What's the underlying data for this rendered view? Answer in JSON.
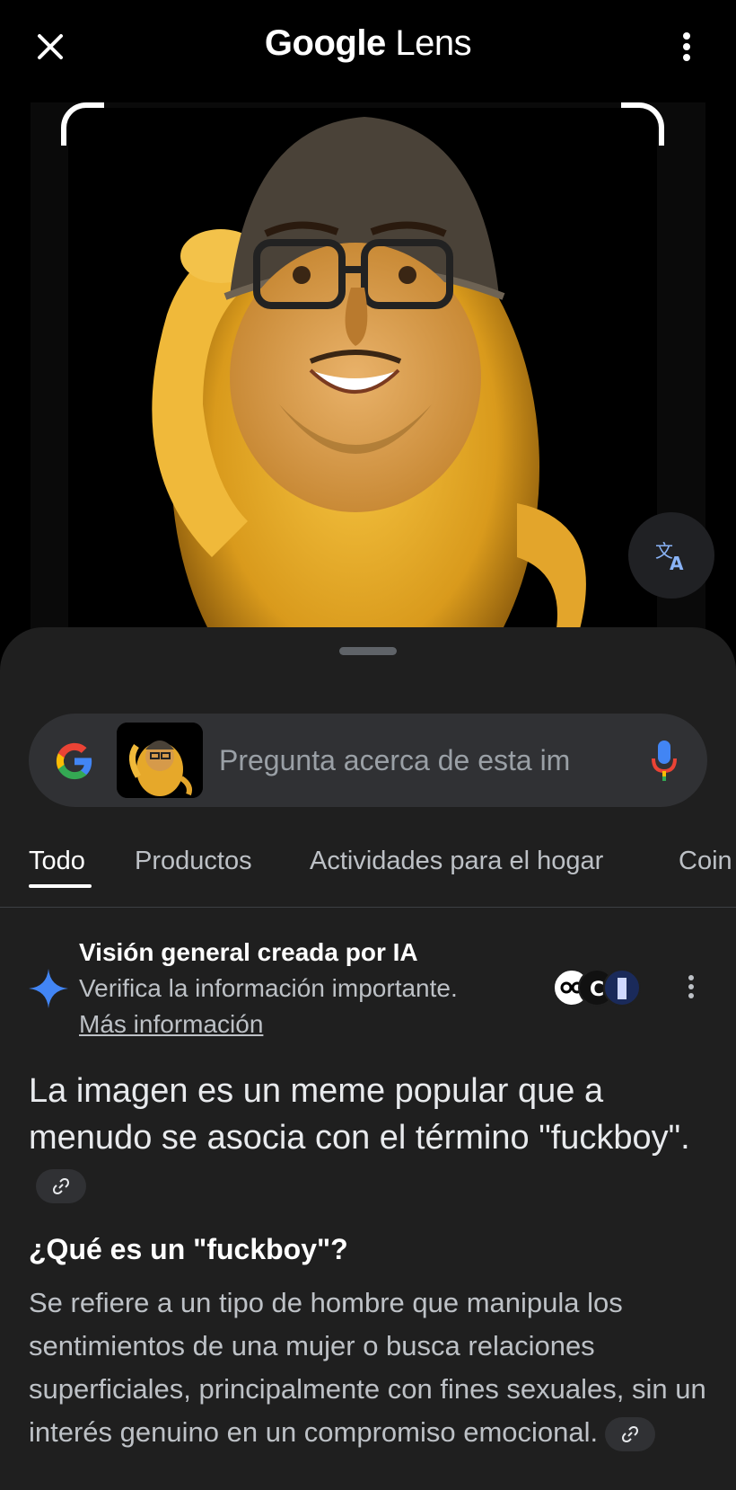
{
  "header": {
    "brand": "Google",
    "product": "Lens",
    "close_icon": "close-icon",
    "menu_icon": "more-vert-icon"
  },
  "image": {
    "description_icon": "meme-image",
    "translate_icon": "translate-icon"
  },
  "search": {
    "placeholder": "Pregunta acerca de esta im",
    "logo_icon": "google-g-icon",
    "mic_icon": "mic-icon"
  },
  "tabs": [
    {
      "label": "Todo",
      "active": true
    },
    {
      "label": "Productos",
      "active": false
    },
    {
      "label": "Actividades para el hogar",
      "active": false
    },
    {
      "label": "Coin",
      "active": false
    }
  ],
  "ai_overview": {
    "title": "Visión general creada por IA",
    "verify": "Verifica la información importante.",
    "more": "Más información",
    "sources_icon": "source-avatars",
    "lead": "La imagen es un meme popular que a menudo se asocia con el término \"fuckboy\".",
    "question": "¿Qué es un \"fuckboy\"?",
    "answer": "Se refiere a un tipo de hombre que manipula los sentimientos de una mujer o busca relaciones superficiales, principalmente con fines sexuales, sin un interés genuino en un compromiso emocional."
  },
  "colors": {
    "background": "#000000",
    "sheet": "#1f1f1f",
    "search_bg": "#303134",
    "accent_blue": "#4285f4"
  }
}
